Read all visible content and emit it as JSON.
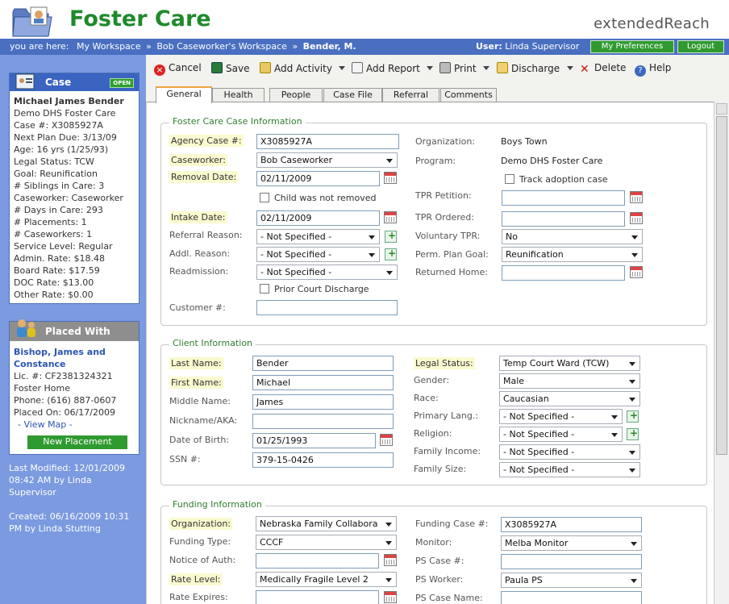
{
  "app": {
    "title": "Foster Care",
    "brand": "extendedReach"
  },
  "breadcrumb": {
    "prefix": "you are here:",
    "items": [
      "My Workspace",
      "Bob Caseworker's Workspace"
    ],
    "current": "Bender, M.",
    "separator": "»"
  },
  "user": {
    "label": "User:",
    "name": "Linda Supervisor"
  },
  "top_buttons": {
    "preferences": "My Preferences",
    "logout": "Logout"
  },
  "case_panel": {
    "title": "Case",
    "badge": "OPEN",
    "name": "Michael James Bender",
    "lines": [
      "Demo DHS Foster Care",
      "Case #: X3085927A",
      "Next Plan Due: 3/13/09",
      "Age: 16 yrs (1/25/93)",
      "Legal Status: TCW",
      "Goal: Reunification",
      "# Siblings in Care: 3",
      "Caseworker: Caseworker",
      "# Days in Care: 293",
      "# Placements: 1",
      "# Caseworkers: 1",
      "Service Level: Regular",
      "Admin. Rate: $18.48",
      "Board Rate: $17.59",
      "DOC Rate: $13.00",
      "Other Rate: $0.00"
    ]
  },
  "placed_panel": {
    "title": "Placed With",
    "name_line1": "Bishop, James and",
    "name_line2": "Constance",
    "lines": [
      "Lic. #: CF2381324321",
      "Foster Home",
      "Phone: (616) 887-0607",
      "Placed On: 06/17/2009"
    ],
    "view_map": "- View Map -",
    "new_placement": "New Placement"
  },
  "side_info": {
    "modified_1": "Last Modified: 12/01/2009",
    "modified_2": "08:42 AM by Linda",
    "modified_3": "Supervisor",
    "created_1": "Created: 06/16/2009 10:31",
    "created_2": "PM by Linda Stutting"
  },
  "toolbar": {
    "cancel": "Cancel",
    "save": "Save",
    "add_activity": "Add Activity",
    "add_report": "Add Report",
    "print": "Print",
    "discharge": "Discharge",
    "delete": "Delete",
    "help": "Help"
  },
  "tabs": [
    "General",
    "Health",
    "People",
    "Case File",
    "Referral",
    "Comments"
  ],
  "foster_section": {
    "title": "Foster Care Case Information",
    "agency_case_label": "Agency Case #:",
    "agency_case_value": "X3085927A",
    "caseworker_label": "Caseworker:",
    "caseworker_value": "Bob Caseworker",
    "removal_date_label": "Removal Date:",
    "removal_date_value": "02/11/2009",
    "child_not_removed": "Child was not removed",
    "intake_date_label": "Intake Date:",
    "intake_date_value": "02/11/2009",
    "referral_reason_label": "Referral Reason:",
    "referral_reason_value": "- Not Specified -",
    "addl_reason_label": "Addl. Reason:",
    "addl_reason_value": "- Not Specified -",
    "readmission_label": "Readmission:",
    "readmission_value": "- Not Specified -",
    "prior_court": "Prior Court Discharge",
    "customer_label": "Customer #:",
    "customer_value": "",
    "organization_label": "Organization:",
    "organization_value": "Boys Town",
    "program_label": "Program:",
    "program_value": "Demo DHS Foster Care",
    "track_adoption": "Track adoption case",
    "tpr_petition_label": "TPR Petition:",
    "tpr_ordered_label": "TPR Ordered:",
    "voluntary_tpr_label": "Voluntary TPR:",
    "voluntary_tpr_value": "No",
    "perm_goal_label": "Perm. Plan Goal:",
    "perm_goal_value": "Reunification",
    "returned_home_label": "Returned Home:"
  },
  "client_section": {
    "title": "Client Information",
    "last_name_label": "Last Name:",
    "last_name_value": "Bender",
    "first_name_label": "First Name:",
    "first_name_value": "Michael",
    "middle_name_label": "Middle Name:",
    "middle_name_value": "James",
    "nickname_label": "Nickname/AKA:",
    "nickname_value": "",
    "dob_label": "Date of Birth:",
    "dob_value": "01/25/1993",
    "ssn_label": "SSN #:",
    "ssn_value": "379-15-0426",
    "legal_status_label": "Legal Status:",
    "legal_status_value": "Temp Court Ward (TCW)",
    "gender_label": "Gender:",
    "gender_value": "Male",
    "race_label": "Race:",
    "race_value": "Caucasian",
    "primary_lang_label": "Primary Lang.:",
    "primary_lang_value": "- Not Specified -",
    "religion_label": "Religion:",
    "religion_value": "- Not Specified -",
    "family_income_label": "Family Income:",
    "family_income_value": "- Not Specified -",
    "family_size_label": "Family Size:",
    "family_size_value": "- Not Specified -"
  },
  "funding_section": {
    "title": "Funding Information",
    "organization_label": "Organization:",
    "organization_value": "Nebraska Family Collabora",
    "funding_type_label": "Funding Type:",
    "funding_type_value": "CCCF",
    "notice_auth_label": "Notice of Auth:",
    "rate_level_label": "Rate Level:",
    "rate_level_value": "Medically Fragile Level 2",
    "rate_expires_label": "Rate Expires:",
    "funding_case_label": "Funding Case #:",
    "funding_case_value": "X3085927A",
    "monitor_label": "Monitor:",
    "monitor_value": "Melba Monitor",
    "ps_case_label": "PS Case #:",
    "ps_worker_label": "PS Worker:",
    "ps_worker_value": "Paula PS",
    "ps_case_name_label": "PS Case Name:"
  },
  "colors": {
    "brand_green": "#1f8a2c",
    "nav_blue": "#4a6fc0",
    "sidebar_blue": "#7b9ae0",
    "required_bg": "#fafad0"
  }
}
